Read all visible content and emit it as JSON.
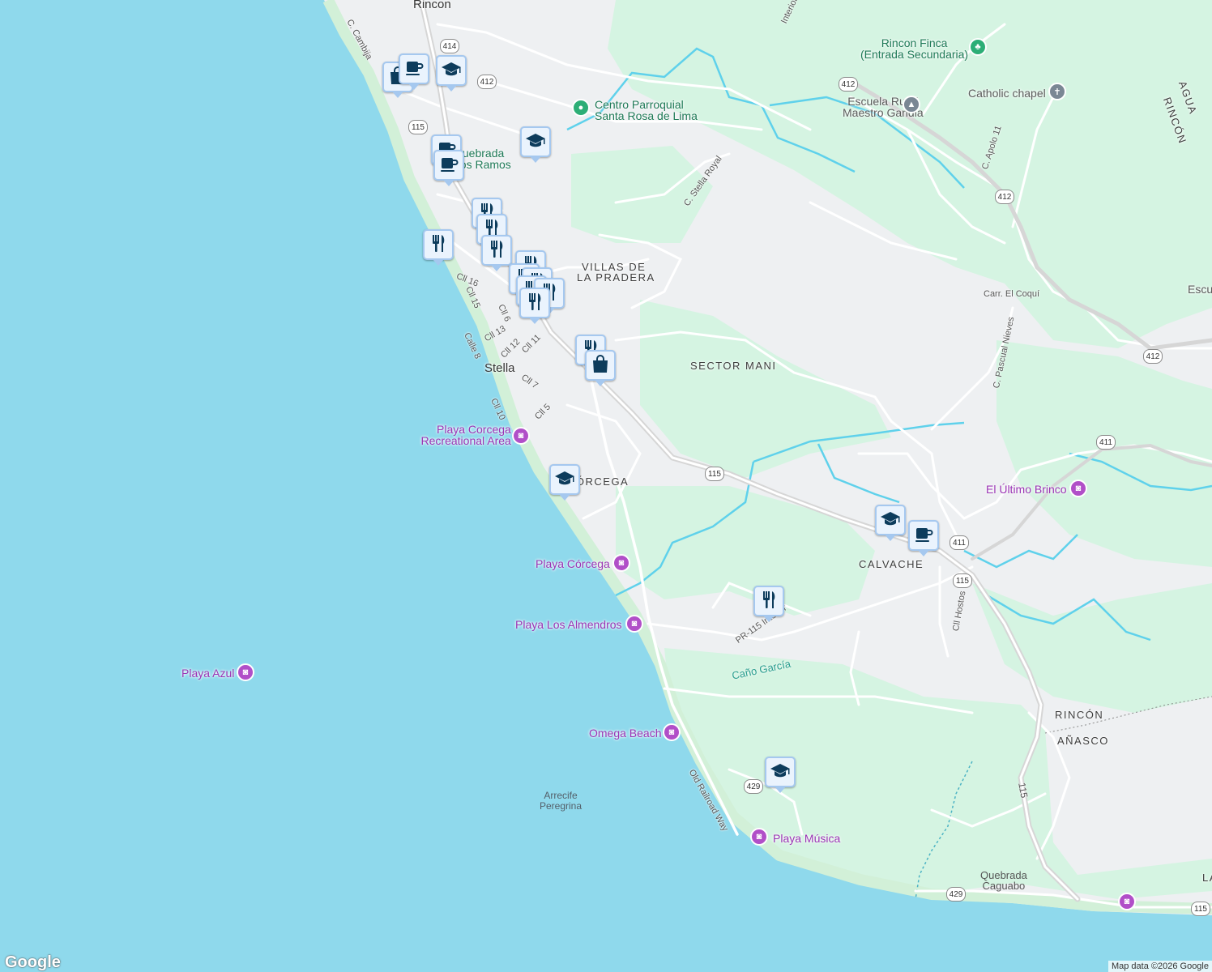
{
  "map": {
    "places": {
      "rincon": "Rincon",
      "stella": "Stella",
      "villas_de_la_pradera_1": "VILLAS DE",
      "villas_de_la_pradera_2": "LA PRADERA",
      "sector_mani": "SECTOR MANI",
      "corcega": "CÓRCEGA",
      "calvache": "CALVACHE",
      "rincon_region": "RINCÓN",
      "anasco_region": "AÑASCO",
      "agua_partial": "AGUA",
      "rincon_partial": "RINCÓN",
      "escu_partial": "Escu",
      "la_partial": "LA"
    },
    "pois": {
      "playa_corcega_rec_1": "Playa Corcega",
      "playa_corcega_rec_2": "Recreational Area",
      "playa_corcega": "Playa Córcega",
      "playa_los_almendros": "Playa Los Almendros",
      "playa_azul": "Playa Azul",
      "omega_beach": "Omega Beach",
      "playa_musica": "Playa Música",
      "el_ultimo_brinco": "El Último Brinco",
      "rincon_finca_1": "Rincon Finca",
      "rincon_finca_2": "(Entrada Secundaria)",
      "catholic_chapel": "Catholic chapel",
      "escuela_1": "Escuela Rural",
      "escuela_2": "Maestro Gandia",
      "centro_parroquial_1": "Centro Parroquial",
      "centro_parroquial_2": "Santa Rosa de Lima",
      "quebrada_ramos_1": "Quebrada",
      "quebrada_ramos_2": "Los Ramos",
      "arrecife_1": "Arrecife",
      "arrecife_2": "Peregrina",
      "quebrada_caguabo_1": "Quebrada",
      "quebrada_caguabo_2": "Caguabo",
      "cano_garcia": "Caño García"
    },
    "streets": {
      "c_cambija": "C. Cambija",
      "c_stella_royal": "C. Stella Royal",
      "c_apolo_11": "C. Apolo 11",
      "carr_el_coqui": "Carr. El Coquí",
      "c_pascual_nieves": "C. Pascual Nieves",
      "interior": "Interior",
      "cll_16": "Cll 16",
      "cll_15": "Cll 15",
      "cll_6": "Cll 6",
      "cll_13": "Cll 13",
      "calle_8": "Calle 8",
      "cll_12": "Cll 12",
      "cll_11": "Cll 11",
      "cll_7": "Cll 7",
      "cll_10": "Cll 10",
      "cll_5": "Cll 5",
      "pr115_interior": "PR-115 Interior",
      "old_railroad_way": "Old Railroad Way",
      "cll_hostos": "Cll Hostos",
      "road_115": "115"
    },
    "shields": {
      "r414": "414",
      "r412": "412",
      "r115": "115",
      "r411": "411",
      "r429": "429"
    },
    "footer": {
      "google": "Google",
      "attribution": "Map data ©2026 Google"
    },
    "colors": {
      "water": "#8fd9ec",
      "land": "#eef0f2",
      "park": "#d5f4e2",
      "beach": "#d2f0d8",
      "road": "#ffffff",
      "river": "#5fd1eb",
      "highway": "#d6d6d6",
      "marker_fill": "#eaf3fd",
      "marker_border": "#a5c8ef",
      "marker_icon": "#0d3c5c",
      "poi_purple": "#b14fc8"
    },
    "markers": [
      {
        "type": "shopping-bag-icon"
      },
      {
        "type": "coffee-cup-icon"
      },
      {
        "type": "graduation-cap-icon"
      },
      {
        "type": "graduation-cap-icon"
      },
      {
        "type": "coffee-cup-icon"
      },
      {
        "type": "coffee-cup-icon"
      },
      {
        "type": "fork-knife-icon"
      },
      {
        "type": "fork-knife-icon"
      },
      {
        "type": "fork-knife-icon"
      },
      {
        "type": "fork-knife-icon"
      },
      {
        "type": "fork-knife-icon"
      },
      {
        "type": "fork-knife-icon"
      },
      {
        "type": "fork-knife-icon"
      },
      {
        "type": "fork-knife-icon"
      },
      {
        "type": "fork-knife-icon"
      },
      {
        "type": "fork-knife-icon"
      },
      {
        "type": "fork-knife-icon"
      },
      {
        "type": "shopping-bag-icon"
      },
      {
        "type": "graduation-cap-icon"
      },
      {
        "type": "graduation-cap-icon"
      },
      {
        "type": "coffee-cup-icon"
      },
      {
        "type": "fork-knife-icon"
      },
      {
        "type": "graduation-cap-icon"
      }
    ]
  }
}
